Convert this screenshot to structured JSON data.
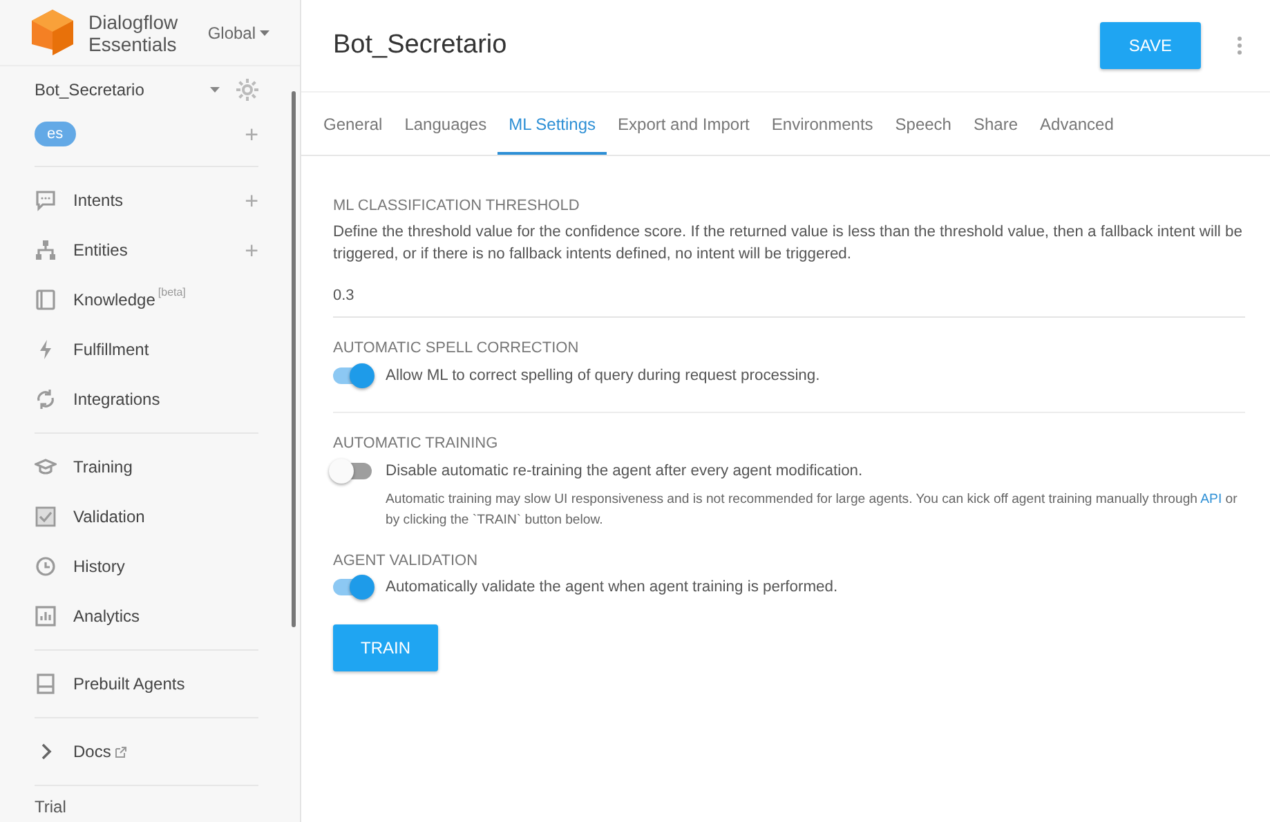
{
  "brand": {
    "name_line_1": "Dialogflow",
    "name_line_2": "Essentials",
    "region": "Global"
  },
  "agent": {
    "name": "Bot_Secretario",
    "language": "es",
    "add_language": "+"
  },
  "sidebar": {
    "groups": [
      {
        "items": [
          {
            "label": "Intents",
            "add": "+"
          },
          {
            "label": "Entities",
            "add": "+"
          },
          {
            "label": "Knowledge",
            "tag": "[beta]"
          },
          {
            "label": "Fulfillment"
          },
          {
            "label": "Integrations"
          }
        ]
      },
      {
        "items": [
          {
            "label": "Training"
          },
          {
            "label": "Validation"
          },
          {
            "label": "History"
          },
          {
            "label": "Analytics"
          }
        ]
      },
      {
        "items": [
          {
            "label": "Prebuilt Agents"
          }
        ]
      },
      {
        "items": [
          {
            "label": "Docs",
            "external": true
          }
        ]
      }
    ],
    "footer": "Trial"
  },
  "header": {
    "title": "Bot_Secretario",
    "save_button": "SAVE"
  },
  "tabs": [
    {
      "label": "General",
      "selected": false
    },
    {
      "label": "Languages",
      "selected": false
    },
    {
      "label": "ML Settings",
      "selected": true
    },
    {
      "label": "Export and Import",
      "selected": false
    },
    {
      "label": "Environments",
      "selected": false
    },
    {
      "label": "Speech",
      "selected": false
    },
    {
      "label": "Share",
      "selected": false
    },
    {
      "label": "Advanced",
      "selected": false
    }
  ],
  "sections": [
    {
      "kind": "value",
      "title": "ML CLASSIFICATION THRESHOLD",
      "description": "Define the threshold value for the confidence score. If the returned value is less than the threshold value, then a fallback intent will be triggered, or if there is no fallback intents defined, no intent will be triggered.",
      "value": "0.3"
    },
    {
      "kind": "toggle",
      "title": "AUTOMATIC SPELL CORRECTION",
      "label": "Allow ML to correct spelling of query during request processing.",
      "on": true,
      "divider": true
    },
    {
      "kind": "toggle",
      "title": "AUTOMATIC TRAINING",
      "label": "Disable automatic re-training the agent after every agent modification.",
      "on": false,
      "note": {
        "before": "Automatic training may slow UI responsiveness and is not recommended for large agents. You can kick off agent training manually through",
        "link": "API",
        "after": "or by clicking the `TRAIN` button below."
      }
    },
    {
      "kind": "toggle",
      "title": "AGENT VALIDATION",
      "label": "Automatically validate the agent when agent training is performed.",
      "on": true
    }
  ],
  "train_button": "TRAIN"
}
